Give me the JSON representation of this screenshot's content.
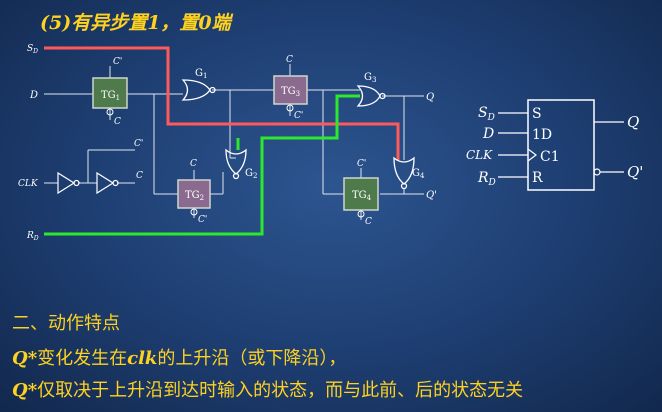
{
  "title": "(5)有异步置1，置0端",
  "circuit": {
    "inputs": {
      "sd": "S",
      "sd_sub": "D",
      "d": "D",
      "clk": "CLK",
      "rd": "R",
      "rd_sub": "D"
    },
    "outputs": {
      "q": "Q",
      "qn": "Q'"
    },
    "tg_labels": {
      "tg1": "TG",
      "tg1_sub": "1",
      "tg2": "TG",
      "tg2_sub": "2",
      "tg3": "TG",
      "tg3_sub": "3",
      "tg4": "TG",
      "tg4_sub": "4"
    },
    "gate_labels": {
      "g1": "G",
      "g1_sub": "1",
      "g2": "G",
      "g2_sub": "2",
      "g3": "G",
      "g3_sub": "3",
      "g4": "G",
      "g4_sub": "4"
    },
    "clock_labels": {
      "c": "C",
      "cn": "C'"
    }
  },
  "symbol": {
    "pins_left": {
      "s": "S",
      "s_sub": "D",
      "d": "D",
      "clk": "CLK",
      "r": "R",
      "r_sub": "D"
    },
    "pins_inside": {
      "s": "S",
      "d": "1D",
      "c": "C1",
      "r": "R"
    },
    "outputs": {
      "q": "Q",
      "qn": "Q'"
    }
  },
  "section": {
    "heading": "二、动作特点",
    "line1_prefix": "Q",
    "line1_star": "*",
    "line1_mid": "变化发生在",
    "line1_clk": "clk",
    "line1_rest": "的上升沿（或下降沿），",
    "line2_prefix": "Q",
    "line2_star": "*",
    "line2_rest": "仅取决于上升沿到达时输入的状态，而与此前、后的状态无关"
  },
  "colors": {
    "title": "#ffd21f",
    "red_wire": "#ff5a5a",
    "green_wire": "#2ee82e",
    "tg_fill_green": "#4e7a4c",
    "tg_fill_purple": "#8a6a8e"
  }
}
